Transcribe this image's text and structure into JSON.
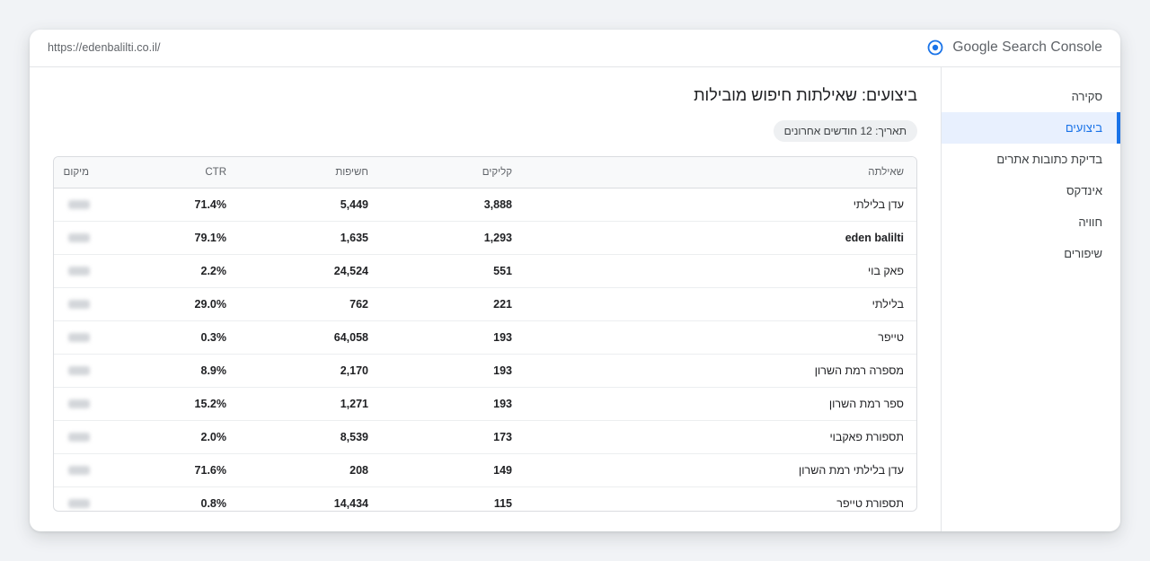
{
  "topbar": {
    "url": "https://edenbalilti.co.il/",
    "app_title": "Google Search Console"
  },
  "sidebar": {
    "items": [
      {
        "label": "סקירה",
        "active": false
      },
      {
        "label": "ביצועים",
        "active": true
      },
      {
        "label": "בדיקת כתובות אתרים",
        "active": false
      },
      {
        "label": "אינדקס",
        "active": false
      },
      {
        "label": "חוויה",
        "active": false
      },
      {
        "label": "שיפורים",
        "active": false
      }
    ]
  },
  "main": {
    "title": "ביצועים: שאילתות חיפוש מובילות",
    "date_filter": "תאריך: 12 חודשים אחרונים"
  },
  "table": {
    "headers": {
      "query": "שאילתה",
      "clicks": "קליקים",
      "impressions": "חשיפות",
      "ctr": "CTR",
      "position": "מיקום"
    },
    "rows": [
      {
        "query": "עדן בלילתי",
        "clicks": "3,888",
        "impressions": "5,449",
        "ctr": "71.4%"
      },
      {
        "query": "eden balilti",
        "clicks": "1,293",
        "impressions": "1,635",
        "ctr": "79.1%"
      },
      {
        "query": "פאק בוי",
        "clicks": "551",
        "impressions": "24,524",
        "ctr": "2.2%"
      },
      {
        "query": "בלילתי",
        "clicks": "221",
        "impressions": "762",
        "ctr": "29.0%"
      },
      {
        "query": "טייפר",
        "clicks": "193",
        "impressions": "64,058",
        "ctr": "0.3%"
      },
      {
        "query": "מספרה רמת השרון",
        "clicks": "193",
        "impressions": "2,170",
        "ctr": "8.9%"
      },
      {
        "query": "ספר רמת השרון",
        "clicks": "193",
        "impressions": "1,271",
        "ctr": "15.2%"
      },
      {
        "query": "תספורת פאקבוי",
        "clicks": "173",
        "impressions": "8,539",
        "ctr": "2.0%"
      },
      {
        "query": "עדן בלילתי רמת השרון",
        "clicks": "149",
        "impressions": "208",
        "ctr": "71.6%"
      },
      {
        "query": "תספורת טייפר",
        "clicks": "115",
        "impressions": "14,434",
        "ctr": "0.8%"
      }
    ]
  },
  "colors": {
    "accent": "#1a73e8",
    "active_bg": "#e8f0fe"
  }
}
